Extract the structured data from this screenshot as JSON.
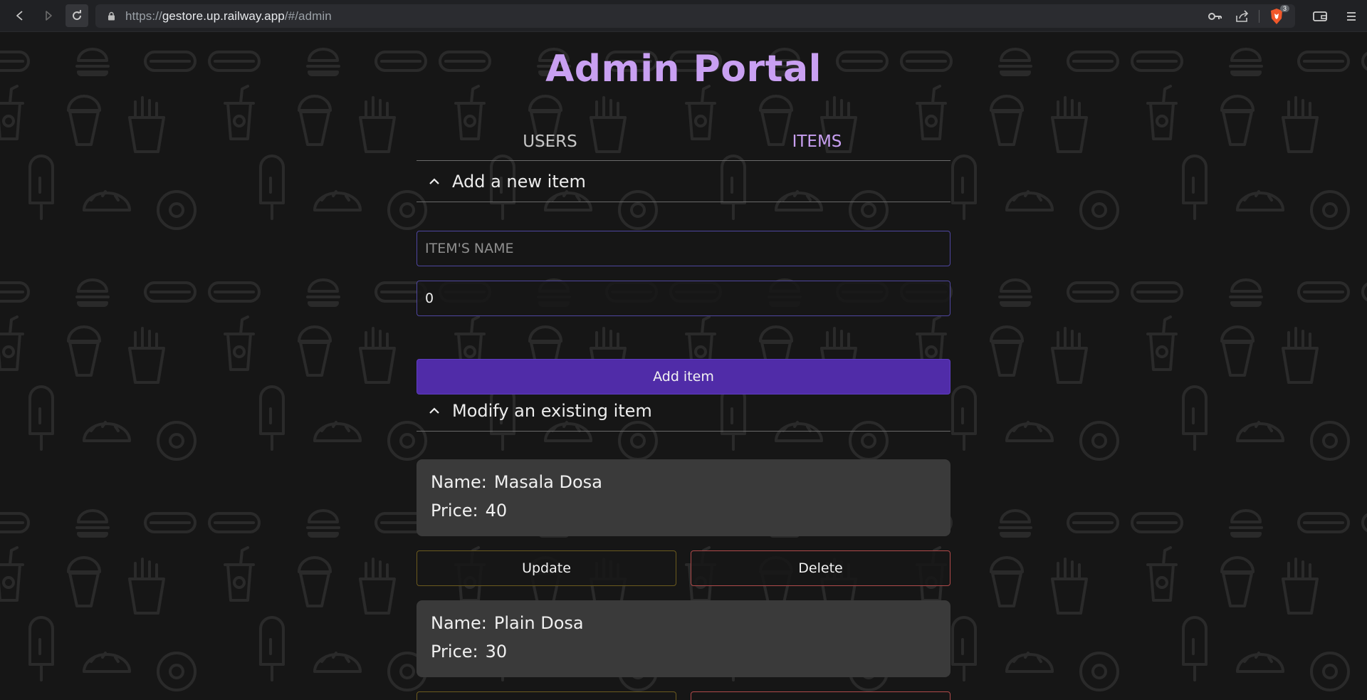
{
  "browser": {
    "url_scheme": "https://",
    "url_host": "gestore.up.railway.app",
    "url_path": "/#/admin",
    "brave_badge": "3",
    "icons": [
      "back-icon",
      "forward-icon",
      "reload-icon",
      "lock-icon",
      "key-icon",
      "share-icon",
      "brave-shield-icon",
      "wallet-icon",
      "menu-icon"
    ]
  },
  "page": {
    "title": "Admin Portal",
    "tabs": [
      {
        "label": "USERS",
        "active": false
      },
      {
        "label": "ITEMS",
        "active": true
      }
    ],
    "add_section": {
      "title": "Add a new item",
      "name_placeholder": "ITEM'S NAME",
      "price_value": "0",
      "add_button": "Add item"
    },
    "modify_section": {
      "title": "Modify an existing item",
      "name_label": "Name:",
      "price_label": "Price:",
      "update_label": "Update",
      "delete_label": "Delete",
      "items": [
        {
          "name": "Masala Dosa",
          "price": "40"
        },
        {
          "name": "Plain Dosa",
          "price": "30"
        }
      ]
    }
  },
  "colors": {
    "accent": "#c9a0f2",
    "primary_button": "#502ca8",
    "card_bg": "#3a3a3a",
    "page_bg": "#161616",
    "update_border": "#6b5a1e",
    "delete_border": "#b04a4a"
  }
}
